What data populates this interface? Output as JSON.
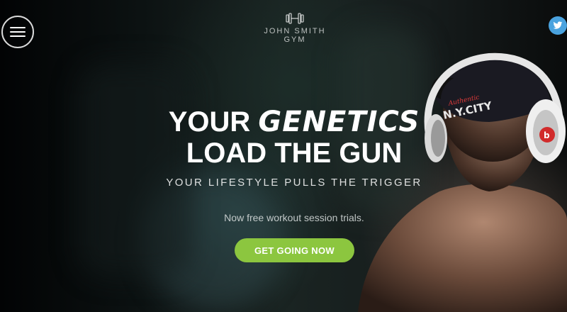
{
  "header": {
    "brand_line1": "JOHN SMITH",
    "brand_line2": "GYM",
    "logo_icon": "dumbbell-icon",
    "menu_icon": "hamburger-menu-icon",
    "social_icon": "twitter-icon"
  },
  "hero": {
    "headline_part1": "YOUR",
    "headline_accent": "GENETICS",
    "headline_line2": "LOAD THE GUN",
    "subtitle": "YOUR LIFESTYLE PULLS THE TRIGGER",
    "tagline": "Now free workout session trials.",
    "cta_label": "GET GOING NOW"
  },
  "colors": {
    "accent": "#8cc63f",
    "twitter": "#4aa3df",
    "text": "#ffffff"
  }
}
